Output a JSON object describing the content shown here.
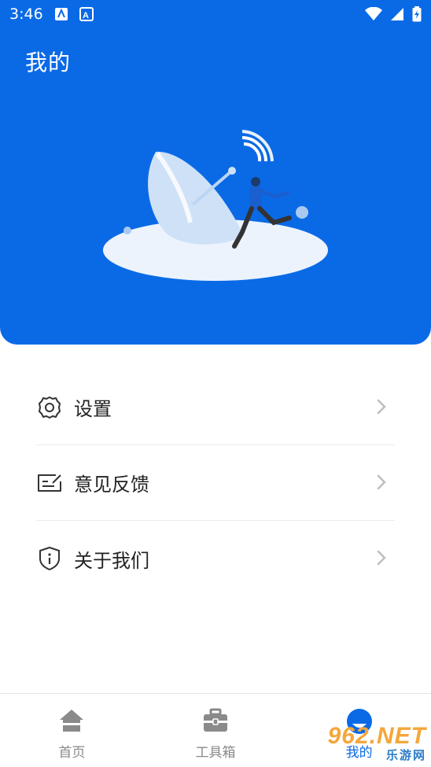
{
  "status_bar": {
    "time": "3:46"
  },
  "header": {
    "title": "我的"
  },
  "menu": {
    "items": [
      {
        "label": "设置",
        "icon": "gear-icon"
      },
      {
        "label": "意见反馈",
        "icon": "feedback-icon"
      },
      {
        "label": "关于我们",
        "icon": "shield-info-icon"
      }
    ]
  },
  "tabs": [
    {
      "label": "首页",
      "icon": "home-icon",
      "active": false
    },
    {
      "label": "工具箱",
      "icon": "toolbox-icon",
      "active": false
    },
    {
      "label": "我的",
      "icon": "profile-icon",
      "active": true
    }
  ],
  "watermark": {
    "logo": "962.NET",
    "subtitle": "乐游网"
  },
  "colors": {
    "primary": "#0a6ae6",
    "text": "#222222",
    "inactive": "#8a8a8a"
  }
}
